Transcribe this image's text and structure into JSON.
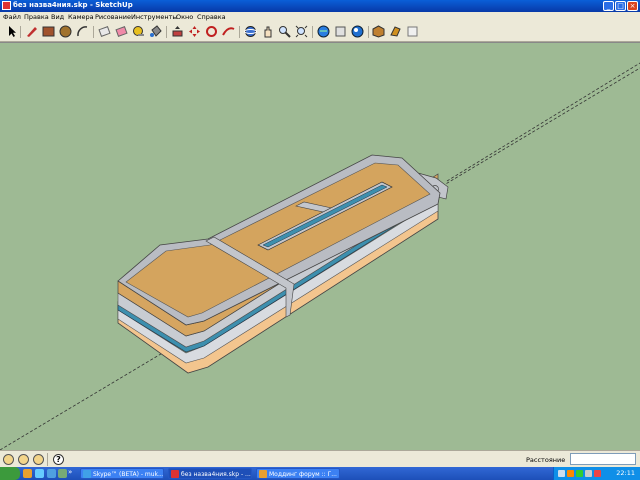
{
  "window": {
    "title": "без назва4ния.skp - SketchUp",
    "buttons": [
      "_",
      "□",
      "×"
    ]
  },
  "menu": [
    "Файл",
    "Правка",
    "Вид",
    "Камера",
    "Рисование",
    "Инструменты",
    "Окно",
    "Справка"
  ],
  "toolbar": {
    "icons": [
      "select-arrow-icon",
      "pencil-line-icon",
      "rectangle-icon",
      "circle-icon",
      "arc-icon",
      "eraser-icon",
      "eraser-pink-icon",
      "tape-measure-icon",
      "paint-bucket-icon",
      "push-pull-icon",
      "move-icon",
      "rotate-icon",
      "follow-me-icon",
      "orbit-icon",
      "pan-icon",
      "zoom-icon",
      "zoom-extents-icon",
      "get-models-icon",
      "share-model-icon",
      "components-icon",
      "3d-warehouse-icon",
      "materials-icon",
      "styles-icon"
    ]
  },
  "colors": {
    "viewport_bg": "#9eba94",
    "wood": "#d4a45e",
    "gray_frame": "#b9bcc3",
    "blue_strip": "#3d8fae",
    "peach_base": "#f3c58e"
  },
  "status": {
    "measurement_label": "Расстояние",
    "measurement_value": ""
  },
  "taskbar": {
    "more_label": "»",
    "tasks": [
      {
        "label": "Skype™ (BETA) - muk..."
      },
      {
        "label": "без назва4ния.skp - ..."
      },
      {
        "label": "Моддинг форум :: Г..."
      }
    ],
    "clock": "22:11"
  }
}
